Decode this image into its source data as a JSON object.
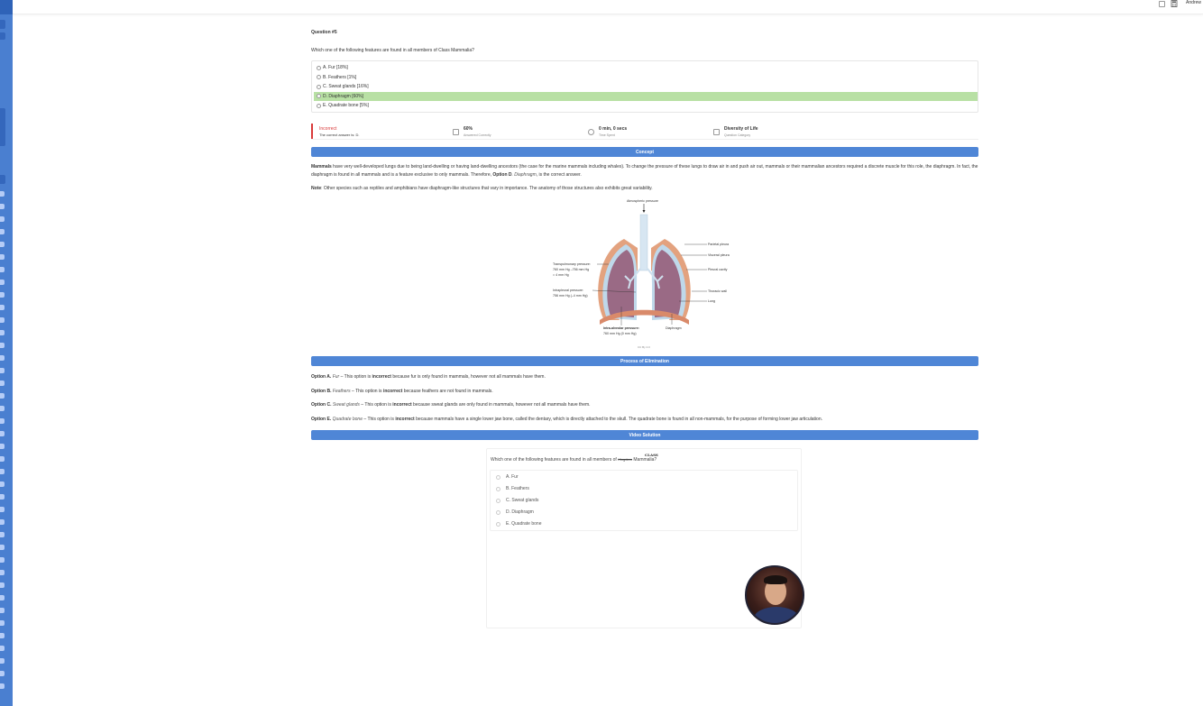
{
  "topbar": {
    "user_name": "Andrew"
  },
  "question": {
    "number_label": "Question #5",
    "text": "Which one of the following features are found in all members of Class Mammalia?",
    "options": [
      {
        "label": "A. Fur [18%]",
        "correct": false
      },
      {
        "label": "B. Feathers [1%]",
        "correct": false
      },
      {
        "label": "C. Sweat glands [16%]",
        "correct": false
      },
      {
        "label": "D. Diaphragm [60%]",
        "correct": true
      },
      {
        "label": "E. Quadrate bone [5%]",
        "correct": false
      }
    ]
  },
  "result": {
    "status": "Incorrect",
    "correct_answer": "The correct answer is: D.",
    "stats": [
      {
        "value": "60%",
        "label": "Answered Correctly",
        "icon": "bar-chart-icon"
      },
      {
        "value": "0 min, 0 secs",
        "label": "Time Spent",
        "icon": "clock-icon"
      },
      {
        "value": "Diversity of Life",
        "label": "Question Category",
        "icon": "calendar-icon"
      }
    ]
  },
  "sections": {
    "concept": "Concept",
    "elimination": "Process of Elimination",
    "video": "Video Solution"
  },
  "concept": {
    "p1_bold": "Mammals",
    "p1_text": " have very well-developed lungs due to being land-dwelling or having land-dwelling ancestors (the case for the marine mammals including whales). To change the pressure of these lungs to draw air in and push air out, mammals or their mammalian ancestors required a discrete muscle for this role, the diaphragm. In fact, the diaphragm is found in all mammals and is a feature exclusive to only mammals. Therefore, ",
    "p1_option_bold": "Option D",
    "p1_option_italic": ". Diaphragm",
    "p1_end": ", is the correct answer.",
    "note_bold": "Note",
    "note_text": ": Other species such as reptiles and amphibians have diaphragm-like structures that vary in importance. The anatomy of those structures also exhibits great variability."
  },
  "diagram": {
    "labels": {
      "atmospheric": "Atmospheric pressure",
      "parietal": "Parietal pleura",
      "visceral": "Visceral pleura",
      "pleural_cavity": "Pleural cavity",
      "thoracic": "Thoracic wall",
      "lung": "Lung",
      "diaphragm": "Diaphragm",
      "transpulmonary_1": "Transpulmonary pressure:",
      "transpulmonary_2": "760 mm Hg –756 mm Hg",
      "transpulmonary_3": "= 4 mm Hg",
      "intrapleural_1": "Intrapleural pressure:",
      "intrapleural_2": "756 mm Hg (–4 mm Hg)",
      "intraalveolar_1": "Intra-alveolar pressure:",
      "intraalveolar_2": "760 mm Hg (0 mm Hg)"
    },
    "credit": "CC By 4.0"
  },
  "elimination": [
    {
      "opt": "Option A.",
      "name": "Fur",
      "pre": " – This option is ",
      "verdict": "incorrect",
      "post": " because fur is only found in mammals, however not all mammals have them."
    },
    {
      "opt": "Option B.",
      "name": "Feathers",
      "pre": " – This option is ",
      "verdict": "incorrect",
      "post": " because feathers are not found in mammals."
    },
    {
      "opt": "Option C.",
      "name": "Sweat glands",
      "pre": " – This option is ",
      "verdict": "incorrect",
      "post": " because sweat glands are only found in mammals, however not all mammals have them."
    },
    {
      "opt": "Option E.",
      "name": "Quadrate bone",
      "pre": " – This option is ",
      "verdict": "incorrect",
      "post": " because mammals have a single lower jaw bone, called the dentary, which is directly attached to the skull. The quadrate bone is found in all non-mammals, for the purpose of forming lower jaw articulation."
    }
  ],
  "video": {
    "question_pre": "Which one of the following features are found in all members of ",
    "question_struck": "Kingdom",
    "question_post": " Mammalia?",
    "handwritten": "CLASS",
    "options": [
      "A. Fur",
      "B. Feathers",
      "C. Sweat glands",
      "D. Diaphragm",
      "E. Quadrate bone"
    ]
  },
  "colors": {
    "accent_blue": "#4f86d6",
    "correct_green": "#b8e0a4",
    "incorrect_red": "#d93a3a",
    "rail_blue": "#4a7fd0"
  }
}
